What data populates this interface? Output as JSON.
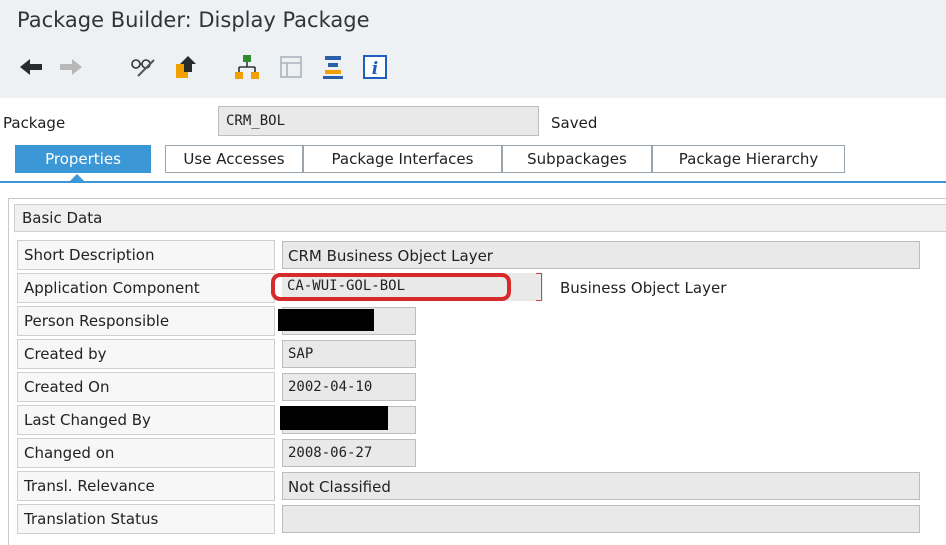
{
  "window": {
    "title": "Package Builder: Display Package"
  },
  "toolbar": {
    "buttons": [
      {
        "icon": "back-arrow-icon"
      },
      {
        "icon": "forward-arrow-icon"
      },
      {
        "icon": "display-change-glasses-icon"
      },
      {
        "icon": "other-object-icon"
      },
      {
        "icon": "hierarchy-icon"
      },
      {
        "icon": "table-view-icon"
      },
      {
        "icon": "align-icon"
      },
      {
        "icon": "info-icon"
      }
    ],
    "colors": {
      "arrow": "#2b2b2b",
      "accent": "#f0a000",
      "green": "#2e8b2e",
      "blue": "#1f5fbf"
    }
  },
  "package": {
    "label": "Package",
    "value": "CRM_BOL",
    "status": "Saved"
  },
  "tabs": [
    {
      "label": "Properties",
      "active": true
    },
    {
      "label": "Use Accesses"
    },
    {
      "label": "Package Interfaces"
    },
    {
      "label": "Subpackages"
    },
    {
      "label": "Package Hierarchy"
    }
  ],
  "basic_data": {
    "heading": "Basic Data",
    "short_description": {
      "label": "Short Description",
      "value": "CRM Business Object Layer"
    },
    "application_component": {
      "label": "Application Component",
      "value": "CA-WUI-GOL-BOL",
      "text": "Business Object Layer"
    },
    "person_responsible": {
      "label": "Person Responsible",
      "value": ""
    },
    "created_by": {
      "label": "Created by",
      "value": "SAP"
    },
    "created_on": {
      "label": "Created On",
      "value": "2002-04-10"
    },
    "last_changed_by": {
      "label": "Last Changed By",
      "value": ""
    },
    "changed_on": {
      "label": "Changed on",
      "value": "2008-06-27"
    },
    "transl_relevance": {
      "label": "Transl. Relevance",
      "value": "Not Classified"
    },
    "translation_status": {
      "label": "Translation Status",
      "value": ""
    }
  },
  "highlight_color": "#d72b2b",
  "tab_accent_color": "#3b97d6"
}
